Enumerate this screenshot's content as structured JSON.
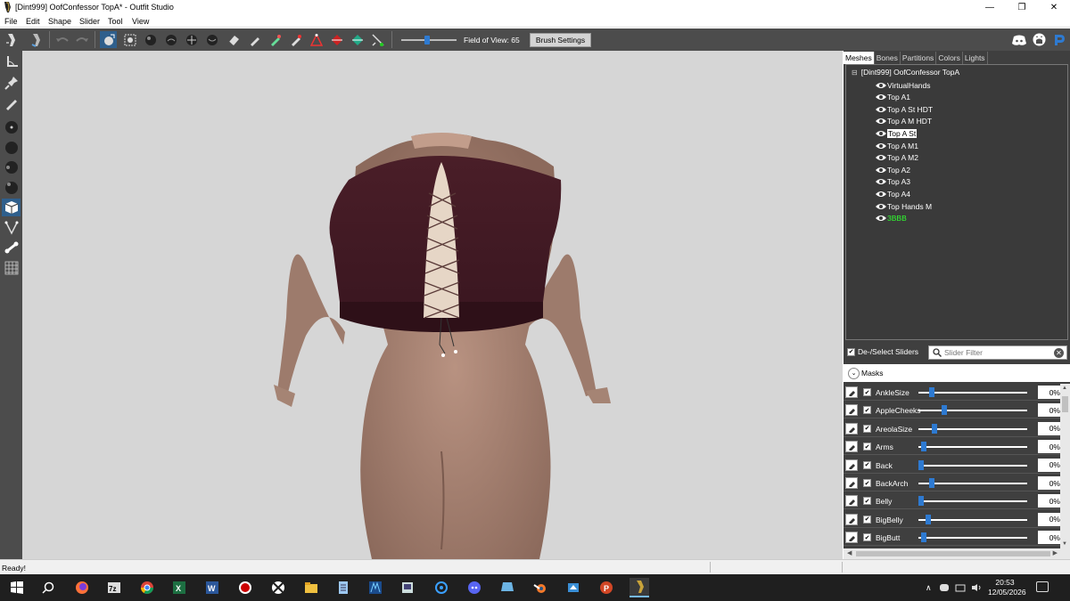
{
  "window": {
    "title": "[Dint999] OofConfessor TopA* - Outfit Studio",
    "minimize_glyph": "—",
    "maximize_glyph": "❐",
    "close_glyph": "✕"
  },
  "menu": [
    "File",
    "Edit",
    "Shape",
    "Slider",
    "Tool",
    "View"
  ],
  "toolbar": {
    "fov_label": "Field of View: 65",
    "fov_value": 65,
    "brush_settings_label": "Brush Settings"
  },
  "right_panel": {
    "tabs": [
      "Meshes",
      "Bones",
      "Partitions",
      "Colors",
      "Lights"
    ],
    "active_tab": "Meshes",
    "tree_root": "[Dint999] OofConfessor TopA",
    "tree_toggle": "⊟",
    "meshes": [
      {
        "name": "VirtualHands",
        "selected": false,
        "green": false
      },
      {
        "name": "Top A1",
        "selected": false,
        "green": false
      },
      {
        "name": "Top A St HDT",
        "selected": false,
        "green": false
      },
      {
        "name": "Top A M HDT",
        "selected": false,
        "green": false
      },
      {
        "name": "Top A St",
        "selected": true,
        "green": false
      },
      {
        "name": "Top A M1",
        "selected": false,
        "green": false
      },
      {
        "name": "Top A M2",
        "selected": false,
        "green": false
      },
      {
        "name": "Top A2",
        "selected": false,
        "green": false
      },
      {
        "name": "Top A3",
        "selected": false,
        "green": false
      },
      {
        "name": "Top A4",
        "selected": false,
        "green": false
      },
      {
        "name": "Top Hands M",
        "selected": false,
        "green": false
      },
      {
        "name": "3BBB",
        "selected": false,
        "green": true
      }
    ]
  },
  "sliders_panel": {
    "deselect_label": "De-/Select Sliders",
    "filter_placeholder": "Slider Filter",
    "masks_label": "Masks",
    "sliders": [
      {
        "name": "AnkleSize",
        "value": "0%",
        "level": 0.0
      },
      {
        "name": "AppleCheeks",
        "value": "0%",
        "level": 0.09
      },
      {
        "name": "AreolaSize",
        "value": "0%",
        "level": 0.02
      },
      {
        "name": "Arms",
        "value": "0%",
        "level": -0.06
      },
      {
        "name": "Back",
        "value": "0%",
        "level": -0.08
      },
      {
        "name": "BackArch",
        "value": "0%",
        "level": 0.0
      },
      {
        "name": "Belly",
        "value": "0%",
        "level": -0.08
      },
      {
        "name": "BigBelly",
        "value": "0%",
        "level": -0.03
      },
      {
        "name": "BigButt",
        "value": "0%",
        "level": -0.06
      }
    ]
  },
  "status": {
    "text": "Ready!"
  },
  "taskbar": {
    "apps": [
      "start-icon",
      "search-icon",
      "firefox-icon",
      "7zip-icon",
      "chrome-icon",
      "excel-icon",
      "word-icon",
      "obs-icon",
      "xbox-icon",
      "file-explorer-icon",
      "notepad-icon",
      "dyndolod-icon",
      "nifskope-icon",
      "edge-icon",
      "discord-icon",
      "mo2-icon",
      "blender-icon",
      "creation-kit-icon",
      "powerpoint-icon",
      "outfit-studio-icon"
    ],
    "tray_chevron": "∧",
    "time": "20:53",
    "date": "12/05/2026"
  },
  "colors": {
    "toolbar": "#4c4c4c",
    "viewport": "#d6d6d6",
    "accent": "#2e7ad1",
    "green_mesh": "#2fff2f"
  }
}
